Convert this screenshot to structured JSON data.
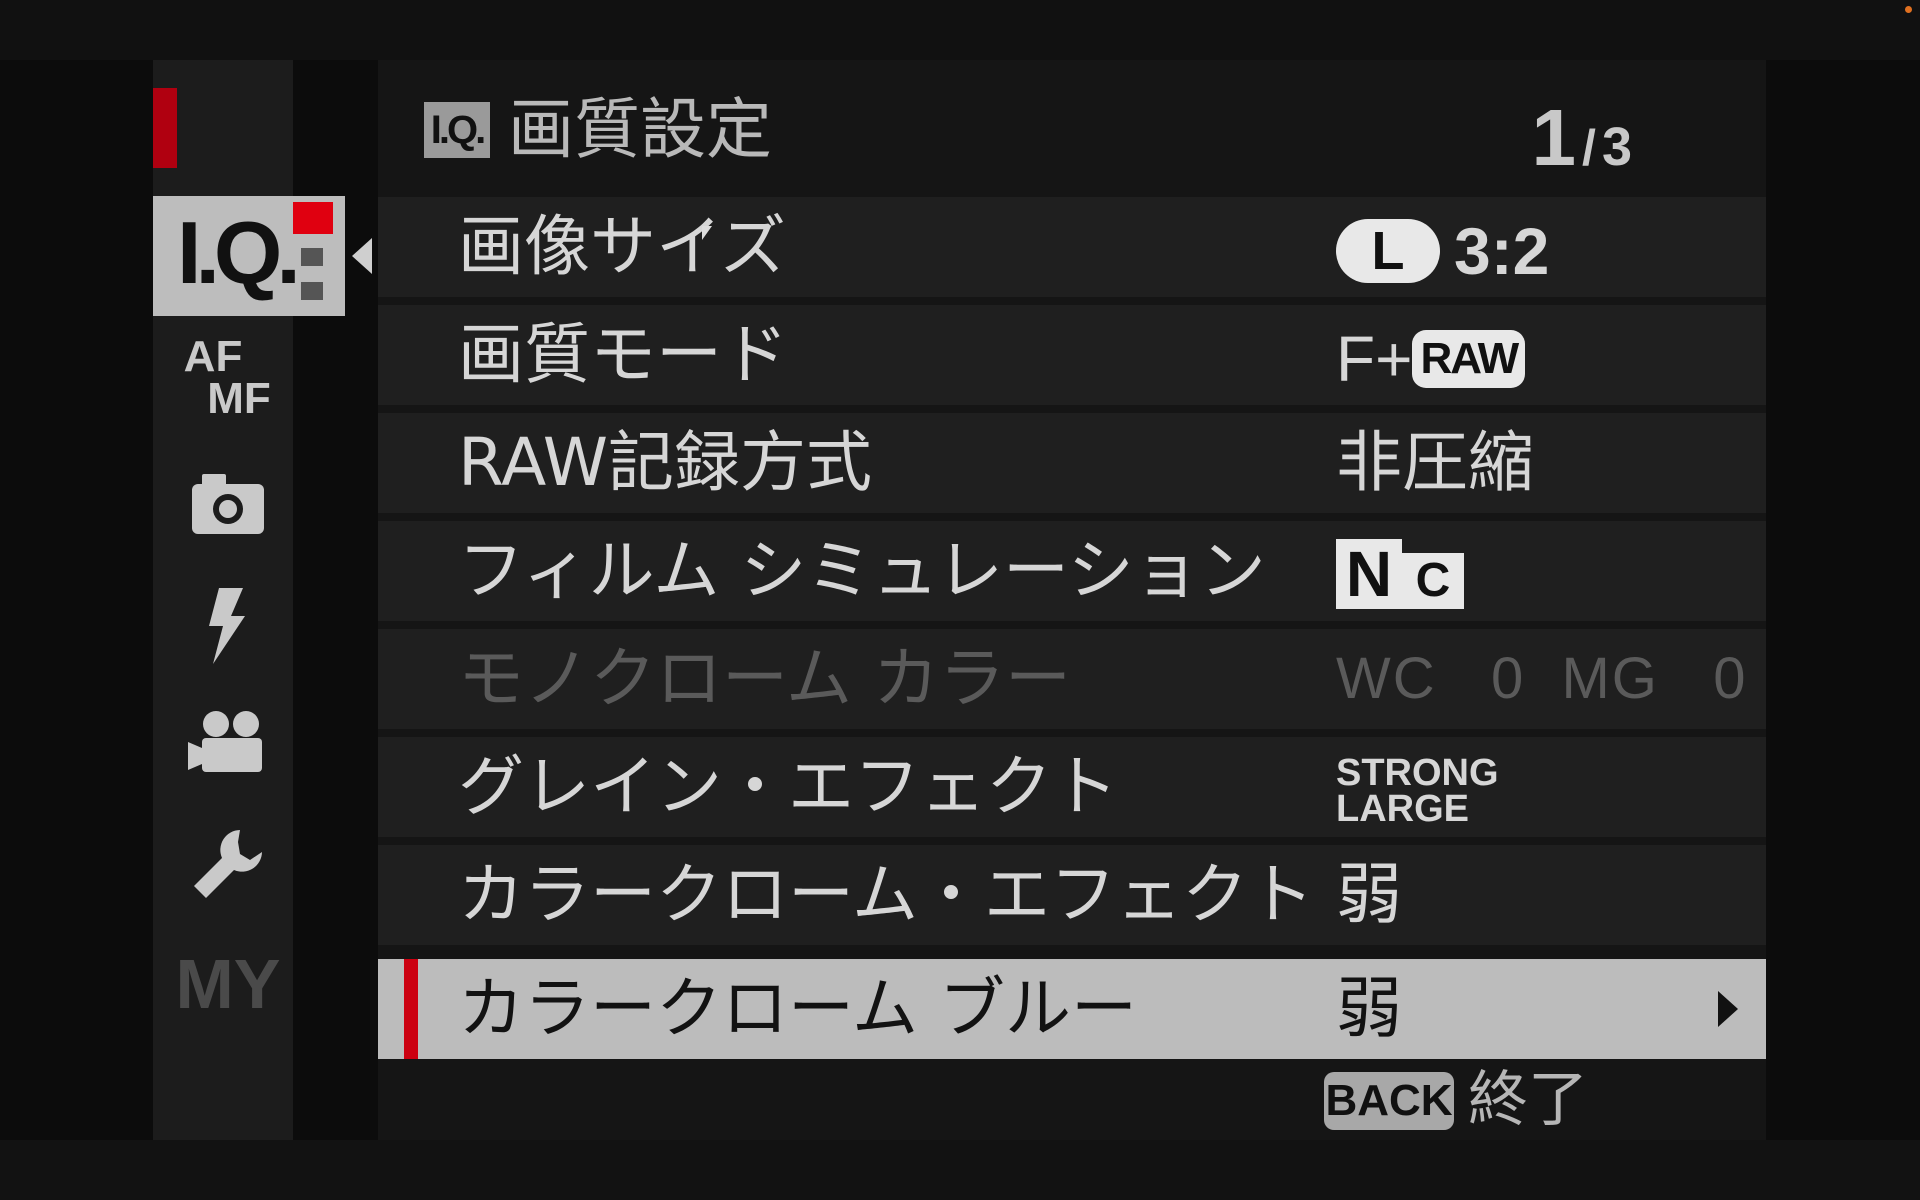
{
  "header": {
    "badge": "I.Q.",
    "title": "画質設定",
    "page_current": "1",
    "page_sep": "/",
    "page_total": "3"
  },
  "tabs": [
    {
      "id": "iq",
      "label": "I.Q.",
      "icon": "image-quality-icon",
      "selected": true
    },
    {
      "id": "afmf",
      "label_line1": "AF",
      "label_line2": "MF",
      "icon": "af-mf-icon"
    },
    {
      "id": "shooting",
      "icon": "camera-icon"
    },
    {
      "id": "flash",
      "icon": "flash-icon"
    },
    {
      "id": "movie",
      "icon": "movie-camera-icon"
    },
    {
      "id": "setup",
      "icon": "wrench-icon"
    },
    {
      "id": "my",
      "label": "MY",
      "icon": "my-menu-icon"
    }
  ],
  "menu": {
    "items": [
      {
        "label": "画像サイズ",
        "value_badge": "L",
        "value": "3:2"
      },
      {
        "label": "画質モード",
        "value": "F+",
        "value_badge": "RAW"
      },
      {
        "label": "RAW記録方式",
        "value": "非圧縮"
      },
      {
        "label": "フィルム シミュレーション",
        "value_badge_n": "N",
        "value_badge_c": "C"
      },
      {
        "label": "モノクローム カラー",
        "value": "WC   0  MG   0",
        "disabled": true
      },
      {
        "label": "グレイン・エフェクト",
        "value_line1": "STRONG",
        "value_line2": "LARGE"
      },
      {
        "label": "カラークローム・エフェクト",
        "value": "弱"
      },
      {
        "label": "カラークローム ブルー",
        "value": "弱",
        "selected": true
      }
    ]
  },
  "footer": {
    "back_label": "BACK",
    "exit_label": "終了"
  },
  "colors": {
    "accent_red": "#cc0010",
    "selected_row": "#bcbcbc",
    "row_bg": "#1f1f1f"
  }
}
